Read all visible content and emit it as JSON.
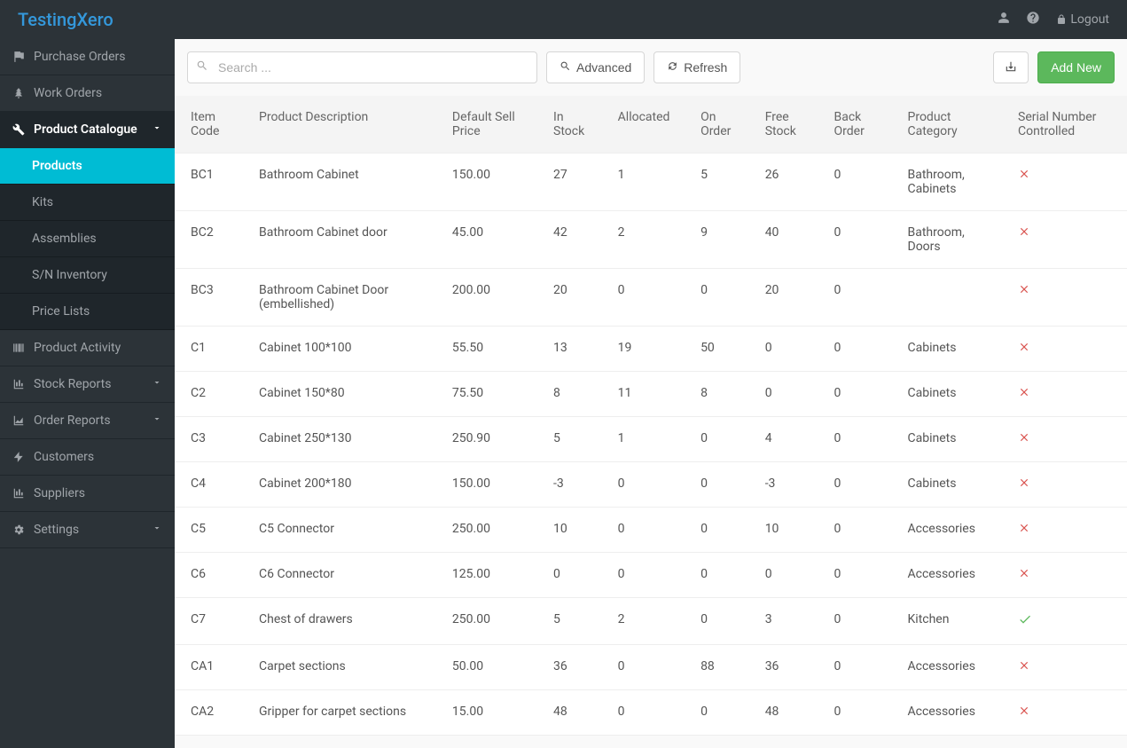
{
  "brand": "TestingXero",
  "header": {
    "logout_label": "Logout"
  },
  "sidebar": {
    "items": [
      {
        "label": "Purchase Orders",
        "icon": "flag"
      },
      {
        "label": "Work Orders",
        "icon": "tree"
      },
      {
        "label": "Product Catalogue",
        "icon": "wrench",
        "expanded": true,
        "sub": [
          {
            "label": "Products",
            "active": true
          },
          {
            "label": "Kits"
          },
          {
            "label": "Assemblies"
          },
          {
            "label": "S/N Inventory"
          },
          {
            "label": "Price Lists"
          }
        ]
      },
      {
        "label": "Product Activity",
        "icon": "barcode"
      },
      {
        "label": "Stock Reports",
        "icon": "bar-chart",
        "chevron": true
      },
      {
        "label": "Order Reports",
        "icon": "area-chart",
        "chevron": true
      },
      {
        "label": "Customers",
        "icon": "bolt"
      },
      {
        "label": "Suppliers",
        "icon": "bar-chart"
      },
      {
        "label": "Settings",
        "icon": "gear",
        "chevron": true
      }
    ]
  },
  "toolbar": {
    "search_placeholder": "Search ...",
    "advanced_label": "Advanced",
    "refresh_label": "Refresh",
    "add_new_label": "Add New"
  },
  "table": {
    "headers": {
      "item_code": "Item Code",
      "description": "Product Description",
      "price": "Default Sell Price",
      "in_stock": "In Stock",
      "allocated": "Allocated",
      "on_order": "On Order",
      "free_stock": "Free Stock",
      "back_order": "Back Order",
      "category": "Product Category",
      "serial": "Serial Number Controlled"
    },
    "rows": [
      {
        "code": "BC1",
        "desc": "Bathroom Cabinet",
        "price": "150.00",
        "in_stock": "27",
        "allocated": "1",
        "on_order": "5",
        "free": "26",
        "back": "0",
        "category": "Bathroom, Cabinets",
        "serial": false
      },
      {
        "code": "BC2",
        "desc": "Bathroom Cabinet door",
        "price": "45.00",
        "in_stock": "42",
        "allocated": "2",
        "on_order": "9",
        "free": "40",
        "back": "0",
        "category": "Bathroom, Doors",
        "serial": false
      },
      {
        "code": "BC3",
        "desc": "Bathroom Cabinet Door (embellished)",
        "price": "200.00",
        "in_stock": "20",
        "allocated": "0",
        "on_order": "0",
        "free": "20",
        "back": "0",
        "category": "",
        "serial": false
      },
      {
        "code": "C1",
        "desc": "Cabinet 100*100",
        "price": "55.50",
        "in_stock": "13",
        "allocated": "19",
        "on_order": "50",
        "free": "0",
        "back": "0",
        "category": "Cabinets",
        "serial": false
      },
      {
        "code": "C2",
        "desc": "Cabinet 150*80",
        "price": "75.50",
        "in_stock": "8",
        "allocated": "11",
        "on_order": "8",
        "free": "0",
        "back": "0",
        "category": "Cabinets",
        "serial": false
      },
      {
        "code": "C3",
        "desc": "Cabinet 250*130",
        "price": "250.90",
        "in_stock": "5",
        "allocated": "1",
        "on_order": "0",
        "free": "4",
        "back": "0",
        "category": "Cabinets",
        "serial": false
      },
      {
        "code": "C4",
        "desc": "Cabinet 200*180",
        "price": "150.00",
        "in_stock": "-3",
        "allocated": "0",
        "on_order": "0",
        "free": "-3",
        "back": "0",
        "category": "Cabinets",
        "serial": false
      },
      {
        "code": "C5",
        "desc": "C5 Connector",
        "price": "250.00",
        "in_stock": "10",
        "allocated": "0",
        "on_order": "0",
        "free": "10",
        "back": "0",
        "category": "Accessories",
        "serial": false
      },
      {
        "code": "C6",
        "desc": "C6 Connector",
        "price": "125.00",
        "in_stock": "0",
        "allocated": "0",
        "on_order": "0",
        "free": "0",
        "back": "0",
        "category": "Accessories",
        "serial": false
      },
      {
        "code": "C7",
        "desc": "Chest of drawers",
        "price": "250.00",
        "in_stock": "5",
        "allocated": "2",
        "on_order": "0",
        "free": "3",
        "back": "0",
        "category": "Kitchen",
        "serial": true
      },
      {
        "code": "CA1",
        "desc": "Carpet sections",
        "price": "50.00",
        "in_stock": "36",
        "allocated": "0",
        "on_order": "88",
        "free": "36",
        "back": "0",
        "category": "Accessories",
        "serial": false
      },
      {
        "code": "CA2",
        "desc": "Gripper for carpet sections",
        "price": "15.00",
        "in_stock": "48",
        "allocated": "0",
        "on_order": "0",
        "free": "48",
        "back": "0",
        "category": "Accessories",
        "serial": false
      }
    ]
  }
}
